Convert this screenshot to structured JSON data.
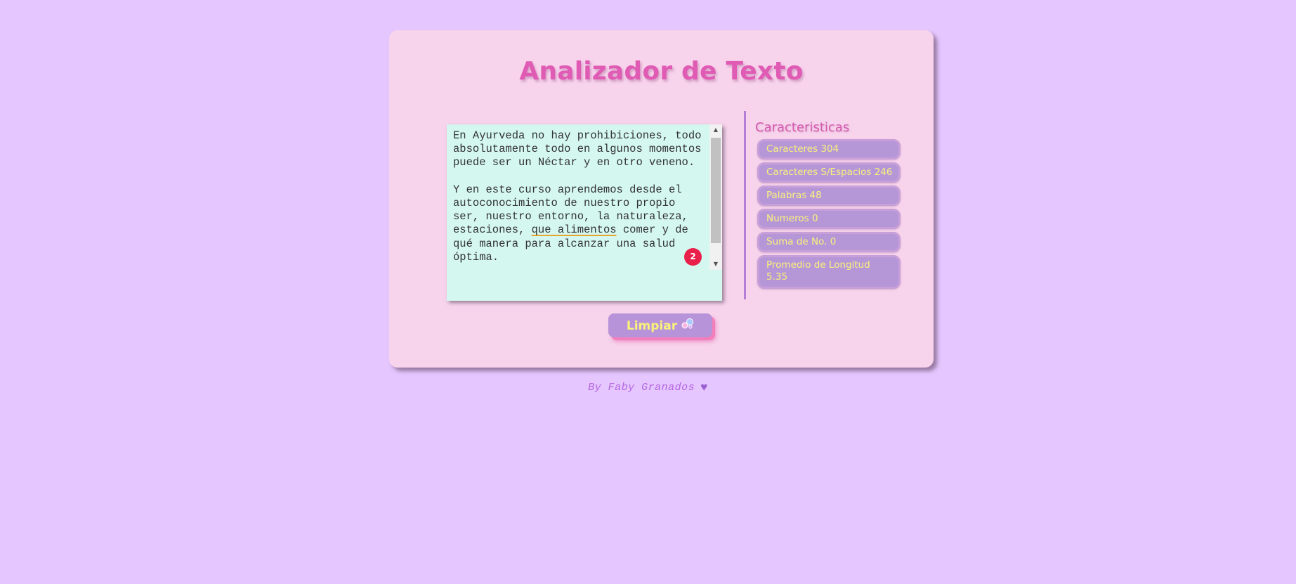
{
  "app": {
    "title": "Analizador de Texto"
  },
  "editor": {
    "text_before_underline": "En Ayurveda no hay prohibiciones, todo absolutamente todo en algunos momentos puede ser un Néctar y en otro veneno.\n\nY en este curso aprendemos desde el autoconocimiento de nuestro propio ser, nuestro entorno, la naturaleza, estaciones, ",
    "underlined_text": "que alimentos",
    "text_after_underline": " comer y de qué manera para alcanzar una salud óptima.",
    "issue_count": "2"
  },
  "panel": {
    "title": "Caracteristicas",
    "stats": [
      {
        "label": "Caracteres 304"
      },
      {
        "label": "Caracteres S/Espacios 246"
      },
      {
        "label": "Palabras 48"
      },
      {
        "label": "Numeros 0"
      },
      {
        "label": "Suma de No. 0"
      },
      {
        "label": "Promedio de Longitud 5.35"
      }
    ]
  },
  "actions": {
    "clear_label": "Limpiar",
    "clear_icon": "bubbles-icon"
  },
  "footer": {
    "credit": "By Faby Granados",
    "icon": "purple-heart-icon"
  },
  "colors": {
    "background": "#e5c6fe",
    "card": "#f7d3ec",
    "title": "#e05bb4",
    "textarea": "#d4f7ef",
    "stat_bg": "#b597d8",
    "stat_text": "#faf27a",
    "badge": "#e8204a",
    "button_shadow": "#f27fbb"
  }
}
